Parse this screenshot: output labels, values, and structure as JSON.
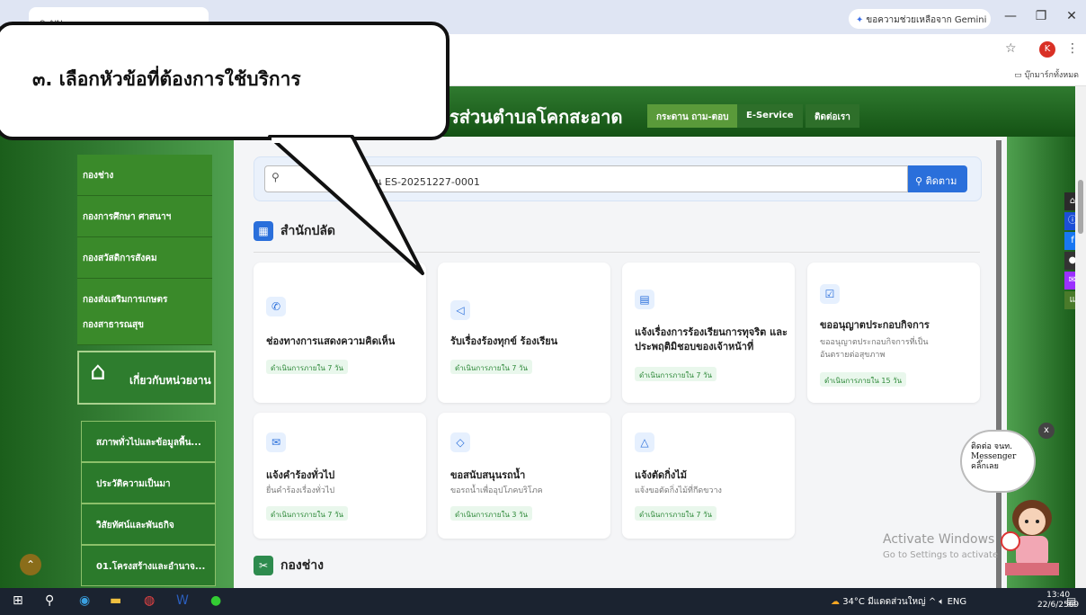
{
  "browser": {
    "tab_title": "ระบบ...",
    "gemini_label": "ขอความช่วยเหลือจาก Gemini",
    "profile_initial": "K",
    "bookmarks_label": "บุ๊กมาร์กทั้งหมด"
  },
  "header": {
    "site_title": "รส่วนตำบลโคกสะอาด",
    "nav": [
      "กระดาน ถาม-ตอบ",
      "E-Service",
      "ติดต่อเรา"
    ]
  },
  "sidebar": {
    "menu": [
      "กองช่าง",
      "กองการศึกษา ศาสนาฯ",
      "กองสวัสดิการสังคม",
      "กองส่งเสริมการเกษตร",
      "กองสาธารณสุข"
    ],
    "about_title": "เกี่ยวกับหน่วยงาน",
    "sub": [
      "สภาพทั่วไปและข้อมูลพื้น...",
      "ประวัติความเป็นมา",
      "วิสัยทัศน์และพันธกิจ",
      "01.โครงสร้างและอำนาจ..."
    ]
  },
  "search": {
    "value": "น ES-20251227-0001",
    "button": "ติดตาม"
  },
  "sections": {
    "s1": "สำนักปลัด",
    "s2": "กองช่าง"
  },
  "cards": [
    {
      "title": "ช่องทางการแสดงความคิดเห็น",
      "desc": "",
      "badge": "ดำเนินการภายใน 7 วัน",
      "icon": "phone-icon"
    },
    {
      "title": "รับเรื่องร้องทุกข์ ร้องเรียน",
      "desc": "",
      "badge": "ดำเนินการภายใน 7 วัน",
      "icon": "megaphone-icon"
    },
    {
      "title": "แจ้งเรื่องการร้องเรียนการทุจริต และประพฤติมิชอบของเจ้าหน้าที่",
      "desc": "",
      "badge": "ดำเนินการภายใน 7 วัน",
      "icon": "document-icon"
    },
    {
      "title": "ขออนุญาตประกอบกิจการ",
      "desc": "ขออนุญาตประกอบกิจการที่เป็นอันตรายต่อสุขภาพ",
      "badge": "ดำเนินการภายใน 15 วัน",
      "icon": "clipboard-icon"
    },
    {
      "title": "แจ้งคำร้องทั่วไป",
      "desc": "ยื่นคำร้องเรื่องทั่วไป",
      "badge": "ดำเนินการภายใน 7 วัน",
      "icon": "mail-icon"
    },
    {
      "title": "ขอสนับสนุนรถน้ำ",
      "desc": "ขอรถน้ำเพื่ออุปโภคบริโภค",
      "badge": "ดำเนินการภายใน 3 วัน",
      "icon": "water-drop-icon"
    },
    {
      "title": "แจ้งตัดกิ่งไม้",
      "desc": "แจ้งขอตัดกิ่งไม้ที่กีดขวาง",
      "badge": "ดำเนินการภายใน 7 วัน",
      "icon": "tree-icon"
    }
  ],
  "callout": {
    "text": "๓. เลือกหัวข้อที่ต้องการใช้บริการ"
  },
  "messenger": {
    "line1": "ติดต่อ จนท.",
    "line2": "Messenger",
    "line3": "คลิ๊กเลย"
  },
  "side_extra": "แบ",
  "watermark": {
    "line1": "Activate Windows",
    "line2": "Go to Settings to activate"
  },
  "taskbar": {
    "weather": "34°C มีแดดส่วนใหญ่",
    "lang": "ENG",
    "time": "13:40",
    "date": "22/6/2569"
  },
  "colors": {
    "brand_green": "#1b5e1b",
    "accent_blue": "#2a6fdb",
    "badge_green": "#2f8a3a"
  }
}
